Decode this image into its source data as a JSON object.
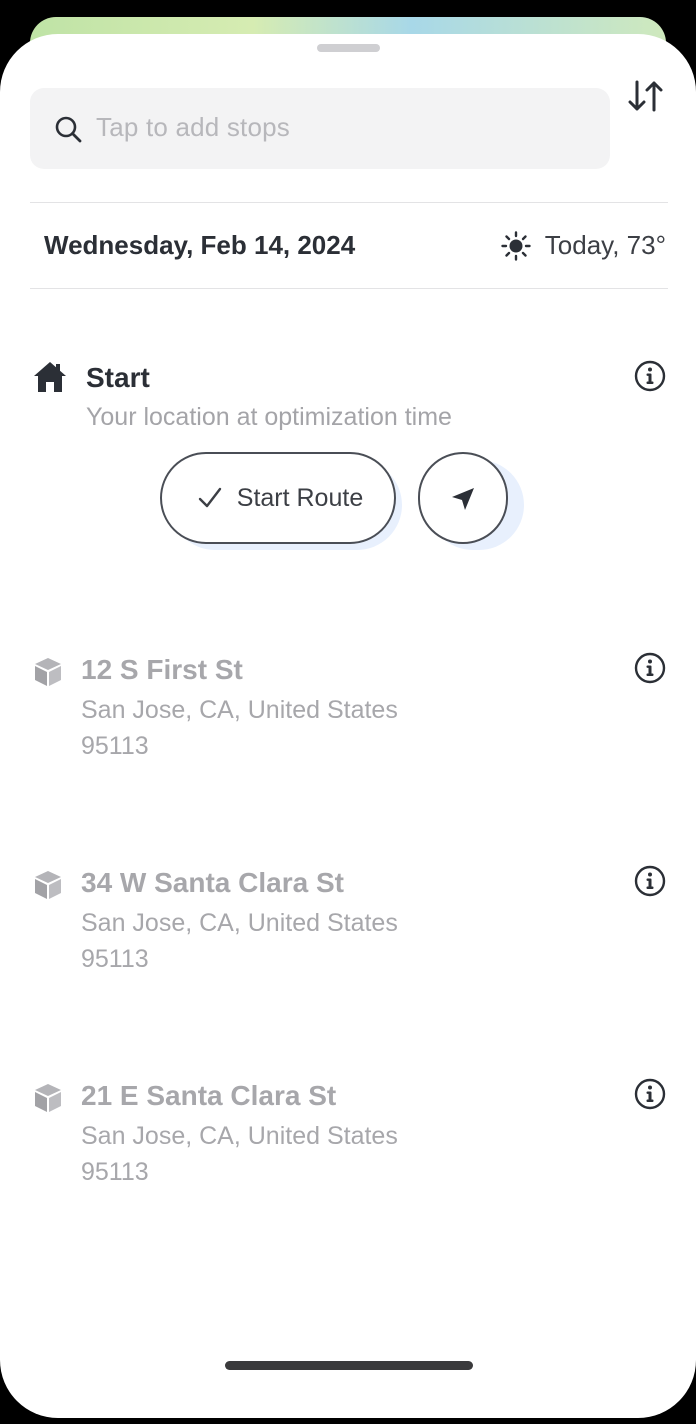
{
  "search": {
    "placeholder": "Tap to add stops"
  },
  "header": {
    "date": "Wednesday, Feb 14, 2024",
    "weather": "Today, 73°",
    "weather_icon": "sun-icon"
  },
  "start": {
    "title": "Start",
    "subtitle": "Your location at optimization time",
    "start_route_label": "Start Route"
  },
  "stops": [
    {
      "title": "12 S First St",
      "line1": "San Jose, CA, United States",
      "line2": "95113"
    },
    {
      "title": "34 W Santa Clara St",
      "line1": "San Jose, CA, United States",
      "line2": "95113"
    },
    {
      "title": "21 E Santa Clara St",
      "line1": "San Jose, CA, United States",
      "line2": "95113"
    }
  ],
  "colors": {
    "accent_fill": "#e8f0fd",
    "text_dark": "#2b2f36",
    "text_muted": "#a7a7ab"
  }
}
